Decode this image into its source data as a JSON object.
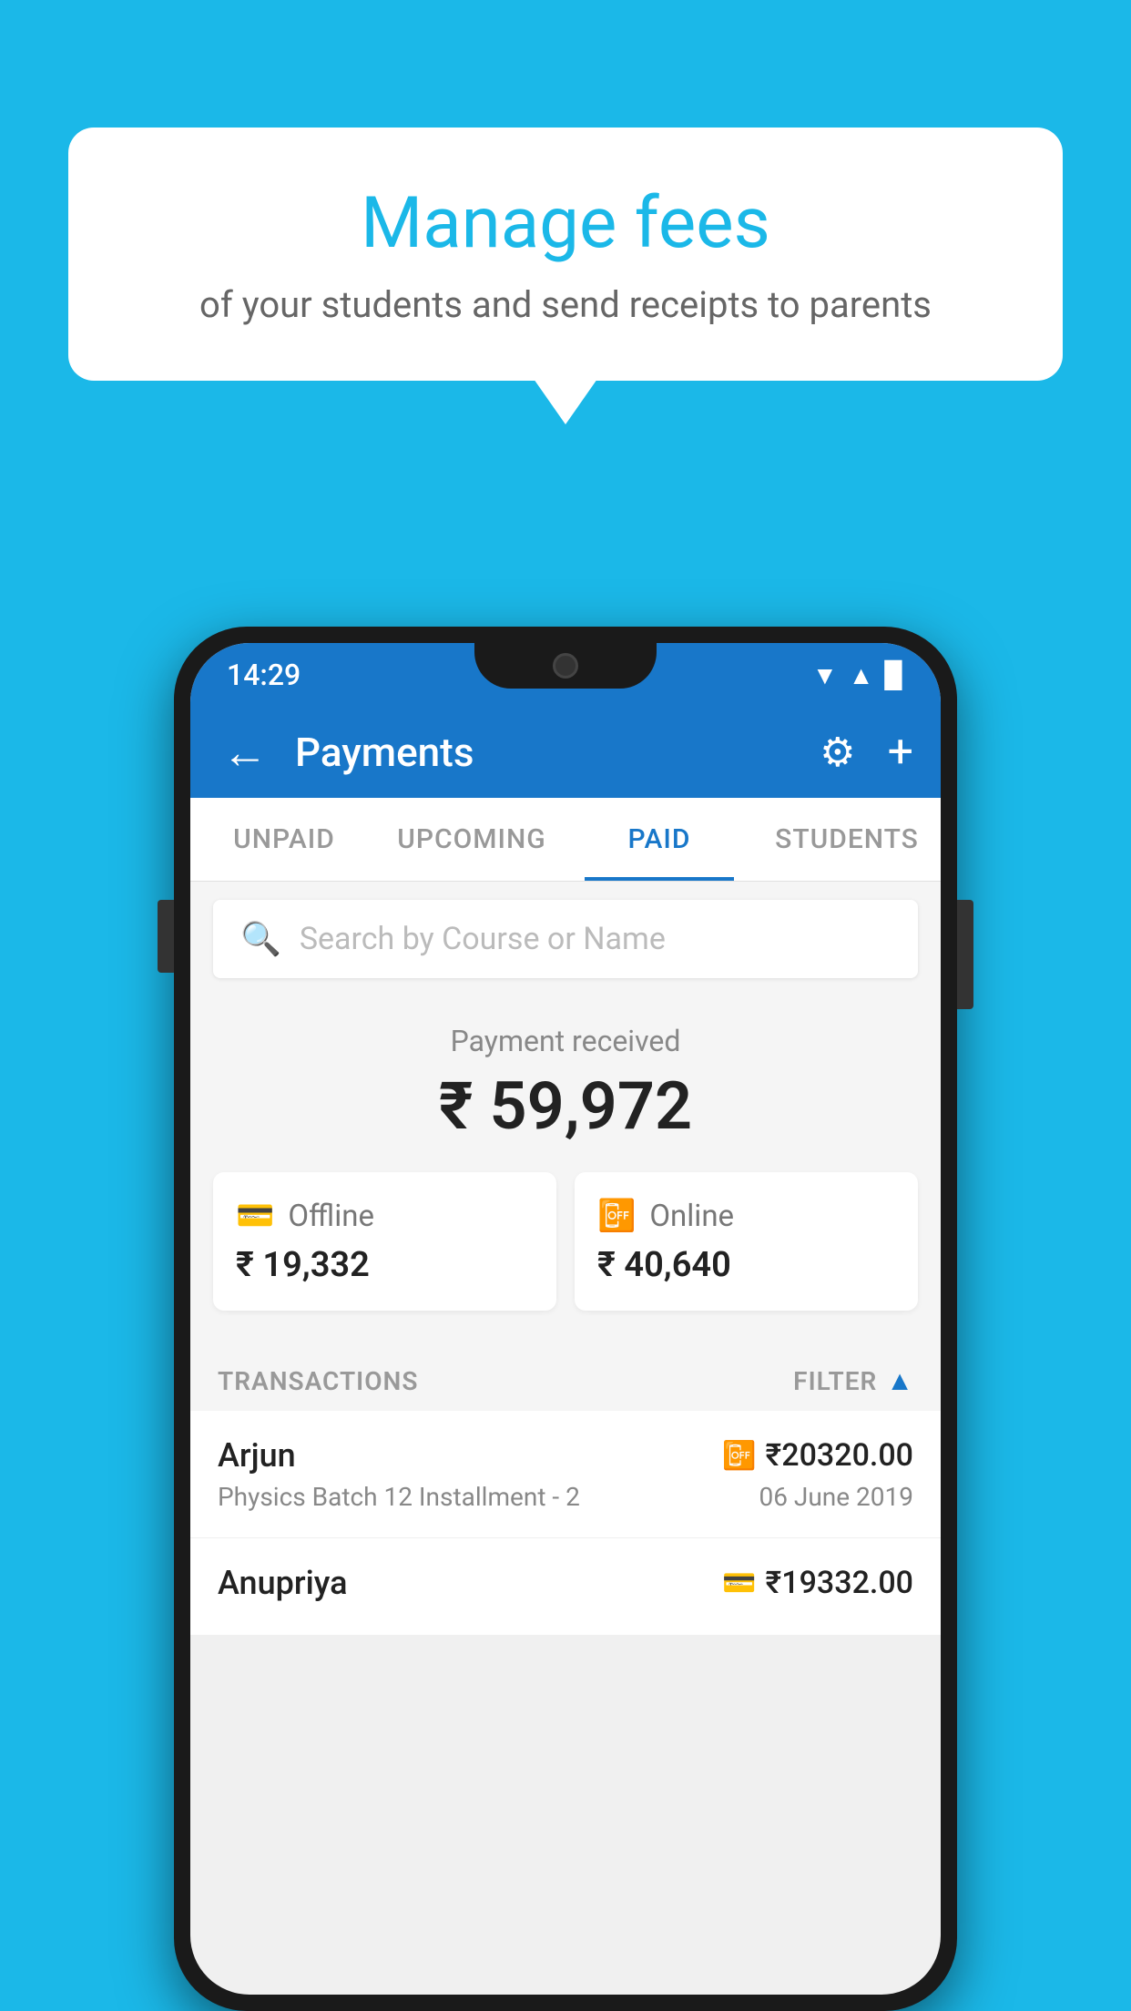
{
  "background_color": "#1BB8E8",
  "bubble": {
    "title": "Manage fees",
    "subtitle": "of your students and send receipts to parents"
  },
  "status_bar": {
    "time": "14:29",
    "wifi": "▲",
    "signal": "▲",
    "battery": "▉"
  },
  "app_bar": {
    "title": "Payments",
    "back_label": "←",
    "gear_label": "⚙",
    "plus_label": "+"
  },
  "tabs": [
    {
      "label": "UNPAID",
      "active": false
    },
    {
      "label": "UPCOMING",
      "active": false
    },
    {
      "label": "PAID",
      "active": true
    },
    {
      "label": "STUDENTS",
      "active": false
    }
  ],
  "search": {
    "placeholder": "Search by Course or Name"
  },
  "payment_summary": {
    "label": "Payment received",
    "total": "₹ 59,972",
    "offline": {
      "type": "Offline",
      "amount": "₹ 19,332"
    },
    "online": {
      "type": "Online",
      "amount": "₹ 40,640"
    }
  },
  "transactions": {
    "header": "TRANSACTIONS",
    "filter": "FILTER",
    "rows": [
      {
        "name": "Arjun",
        "amount": "₹20320.00",
        "course": "Physics Batch 12 Installment - 2",
        "date": "06 June 2019",
        "payment_type": "online"
      },
      {
        "name": "Anupriya",
        "amount": "₹19332.00",
        "course": "",
        "date": "",
        "payment_type": "offline"
      }
    ]
  }
}
